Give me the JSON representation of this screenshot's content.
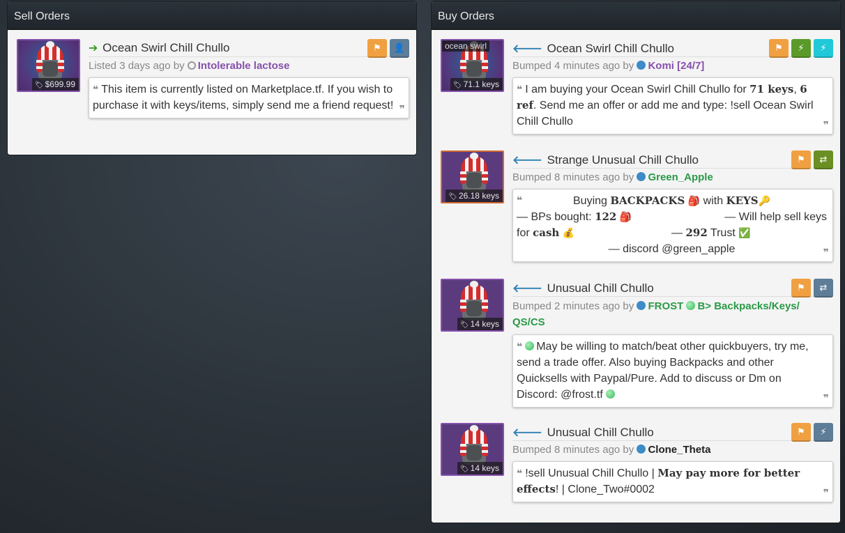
{
  "sell_panel": {
    "title": "Sell Orders",
    "listing": {
      "item_name": "Ocean Swirl Chill Chullo",
      "price": "$699.99",
      "meta_prefix": "Listed 3 days ago by",
      "user": "Intolerable lactose",
      "comment": "This item is currently listed on Marketplace.tf. If you wish to purchase it with keys/items, simply send me a friend request!"
    }
  },
  "buy_panel": {
    "title": "Buy Orders",
    "listings": [
      {
        "item_name": "Ocean Swirl Chill Chullo",
        "effect_label": "ocean swirl",
        "price": "71.1 keys",
        "meta_prefix": "Bumped 4 minutes ago by",
        "user": "Komi [24/7]",
        "comment_a": "I am buying your Ocean Swirl Chill Chullo for ",
        "comment_b": "71 keys",
        "comment_c": ", ",
        "comment_d": "6 ref",
        "comment_e": ". Send me an offer or add me and type: !sell Ocean Swirl Chill Chullo"
      },
      {
        "item_name": "Strange Unusual Chill Chullo",
        "price": "26.18 keys",
        "meta_prefix": "Bumped 8 minutes ago by",
        "user": "Green_Apple",
        "l1a": "Buying ",
        "l1b": "BACKPACKS",
        "l1c": " with ",
        "l1d": "KEYS",
        "l2a": "— BPs bought: ",
        "l2b": "122",
        "l2c": "— Will help sell keys",
        "l3a": "for ",
        "l3b": "cash",
        "l3c": "— ",
        "l3d": "292",
        "l3e": " Trust",
        "l4": "— discord @green_apple"
      },
      {
        "item_name": "Unusual Chill Chullo",
        "price": "14 keys",
        "meta_prefix": "Bumped 2 minutes ago by",
        "user": "FROST",
        "user_suffix": "B> Backpacks/Keys/ QS/CS",
        "comment": "May be willing to match/beat other quickbuyers, try me, send a trade offer. Also buying Backpacks and other Quicksells with Paypal/Pure. Add to discuss or Dm on Discord: @frost.tf"
      },
      {
        "item_name": "Unusual Chill Chullo",
        "price": "14 keys",
        "meta_prefix": "Bumped 8 minutes ago by",
        "user": "Clone_Theta",
        "comment_a": "!sell Unusual Chill Chullo | ",
        "comment_b": "May pay more for better effects",
        "comment_c": "! | Clone_Two#0002"
      }
    ]
  }
}
